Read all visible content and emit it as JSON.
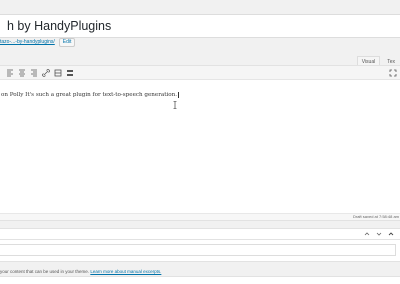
{
  "post": {
    "title": "h by HandyPlugins",
    "permalink_slug": "tazo-...-by-handyplugins/",
    "edit_label": "Edit"
  },
  "editor": {
    "tabs": [
      "Visual",
      "Tex"
    ],
    "content": "on Polly  It's such a great plugin for text-to-speech generation.",
    "status": "Draft saved at 7:58:48 am"
  },
  "excerpt": {
    "help_text": "your content that can be used in your theme. ",
    "help_link": "Learn more about manual excerpts."
  },
  "icons": [
    "bold-icon",
    "align-center-icon",
    "align-right-icon",
    "link-icon",
    "toolbar-toggle-icon",
    "fullscreen-icon",
    "arrow-up-icon",
    "arrow-down-icon",
    "toggle-panel-icon"
  ]
}
